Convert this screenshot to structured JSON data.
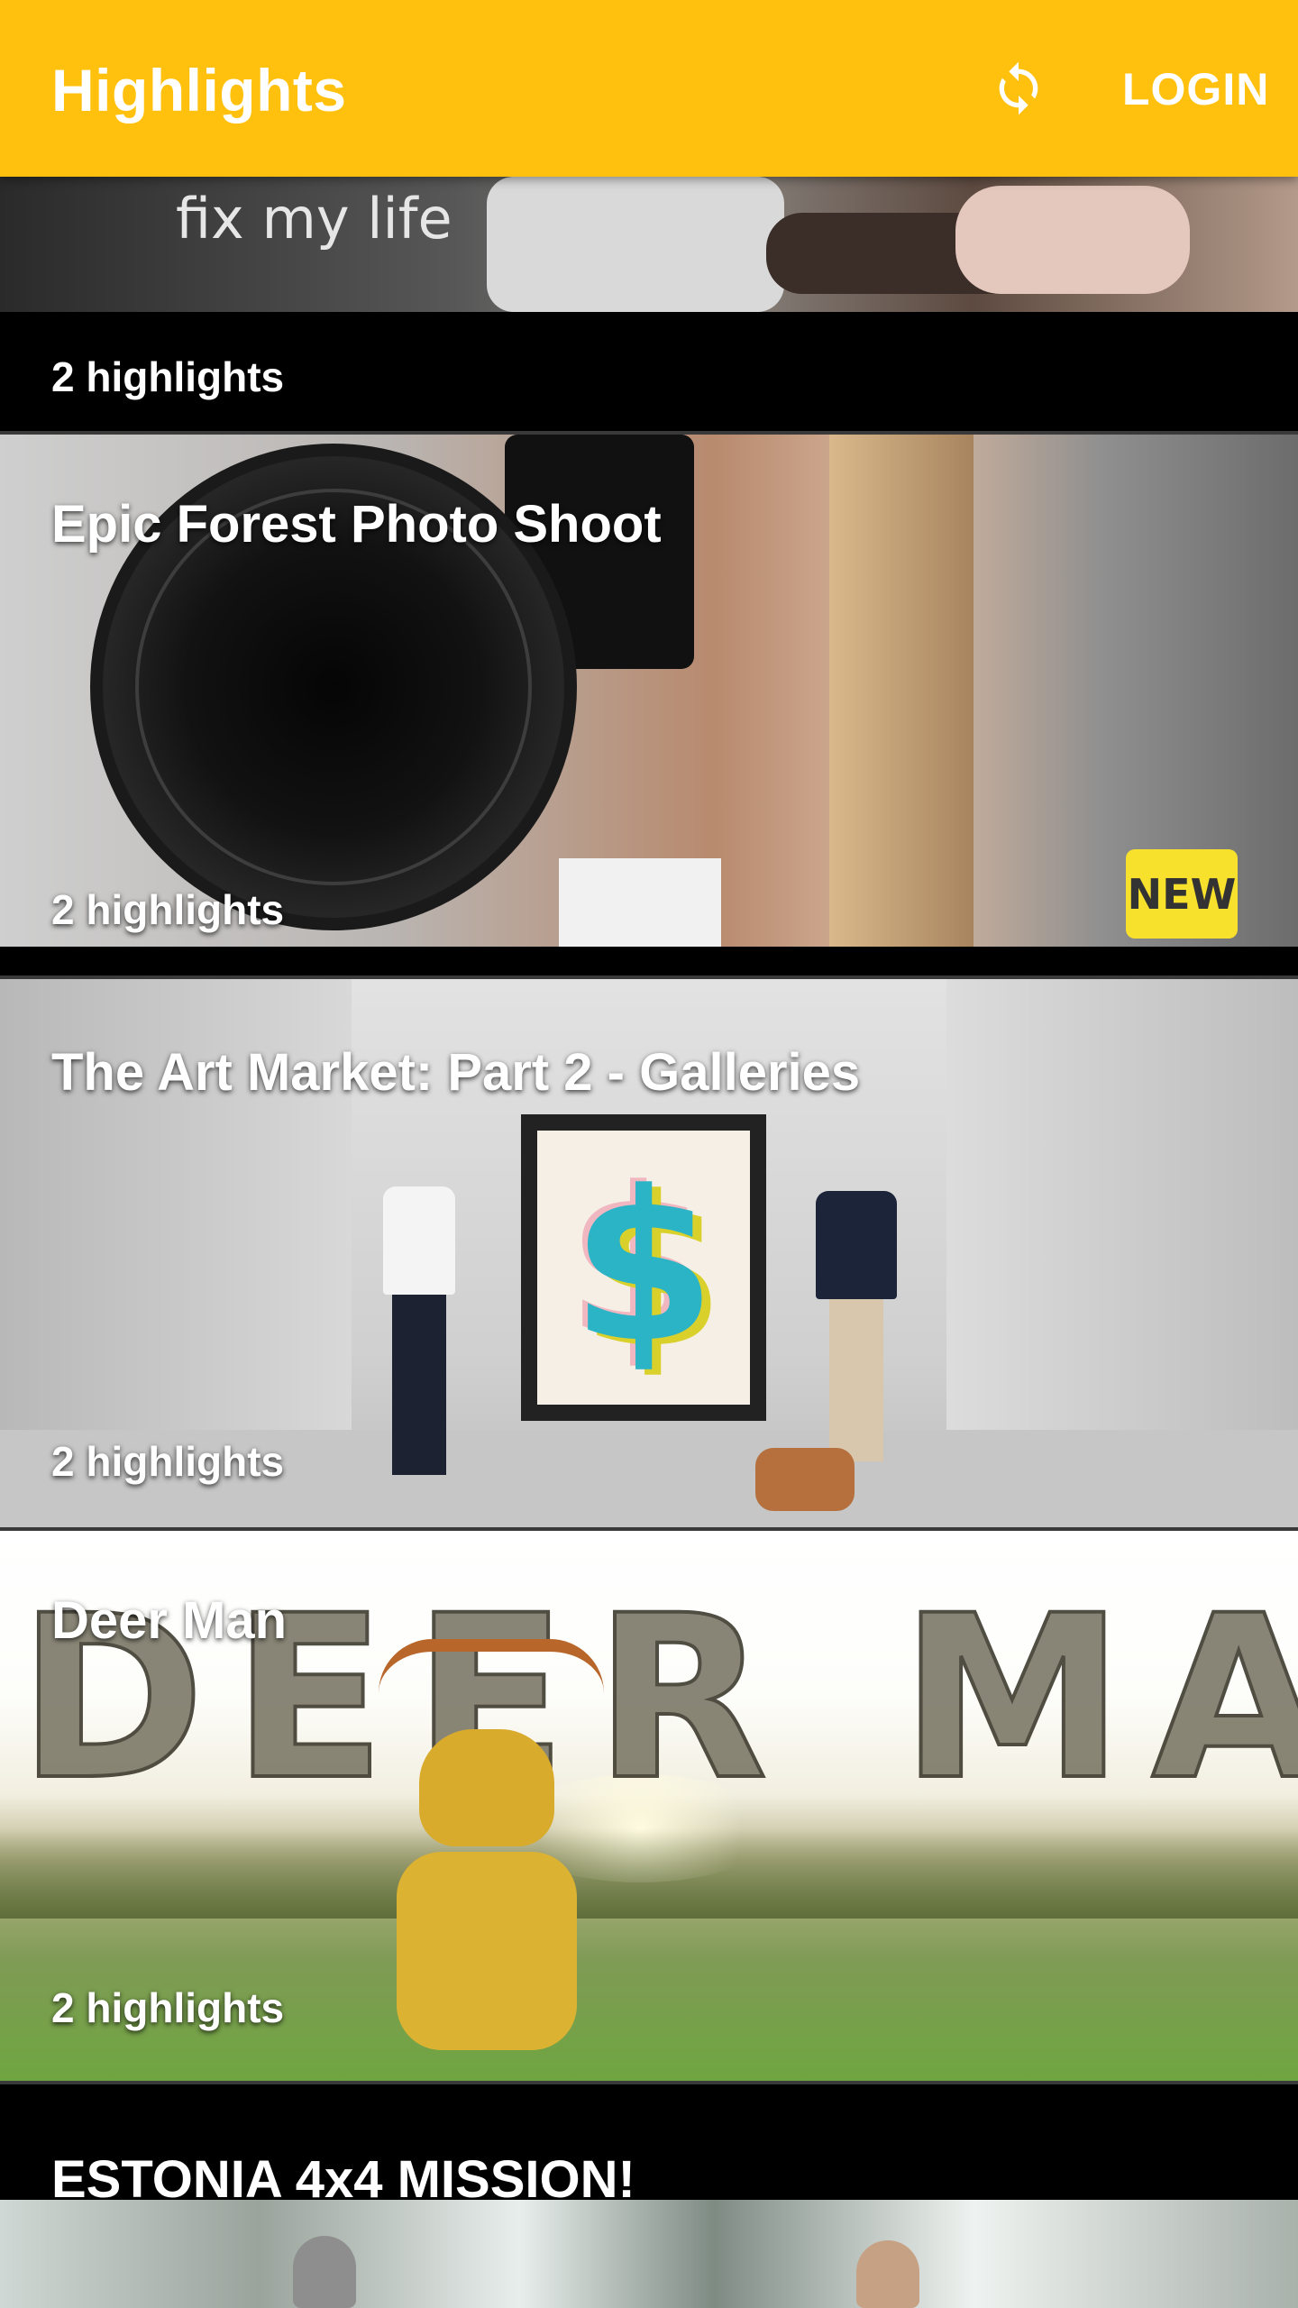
{
  "appbar": {
    "title": "Highlights",
    "refresh_icon": "refresh-icon",
    "login_label": "LOGIN",
    "background_color": "#FFC10E"
  },
  "feed": {
    "items": [
      {
        "title": "",
        "thumbnail_text": "fix my life",
        "highlights_label": "2 highlights",
        "is_new": false
      },
      {
        "title": "Epic Forest Photo Shoot",
        "highlights_label": "2 highlights",
        "is_new": true,
        "new_badge_label": "NEW"
      },
      {
        "title": "The Art Market: Part 2 - Galleries",
        "highlights_label": "2 highlights",
        "is_new": false
      },
      {
        "title": "Deer Man",
        "thumbnail_text": "DEER MAN",
        "highlights_label": "2 highlights",
        "is_new": false
      },
      {
        "title": "ESTONIA 4x4 MISSION!",
        "highlights_label": "",
        "is_new": false
      }
    ]
  },
  "colors": {
    "new_badge": "#F8E12C",
    "background": "#000000"
  }
}
